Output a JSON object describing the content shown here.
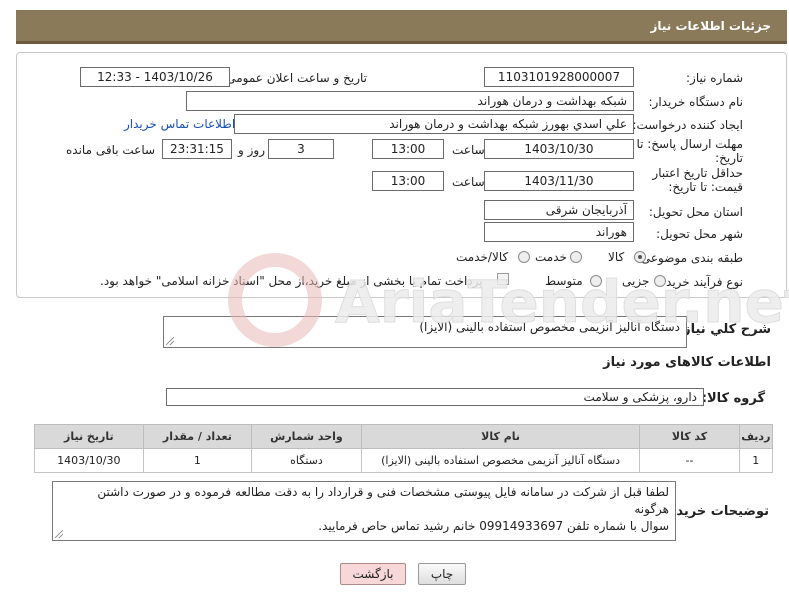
{
  "header": {
    "title": "جزئیات اطلاعات نیاز"
  },
  "form": {
    "need_number_label": "شماره نیاز:",
    "need_number": "1103101928000007",
    "announce_label": "تاریخ و ساعت اعلان عمومی:",
    "announce_value": "1403/10/26 - 12:33",
    "buyer_label": "نام دستگاه خریدار:",
    "buyer_value": "شبکه بهداشت و درمان هوراند",
    "creator_label": "ایجاد کننده درخواست:",
    "creator_value": "علي اسدي بهورز شبکه بهداشت و درمان هوراند",
    "contact_link": "اطلاعات تماس خریدار",
    "deadline_label": "مهلت ارسال پاسخ: تا تاریخ:",
    "deadline_date": "1403/10/30",
    "time_label": "ساعت",
    "deadline_time": "13:00",
    "days_value": "3",
    "days_label": "روز و",
    "remaining_time": "23:31:15",
    "remaining_label": "ساعت باقی مانده",
    "validity_label": "حداقل تاریخ اعتبار قیمت: تا تاریخ:",
    "validity_date": "1403/11/30",
    "validity_time": "13:00",
    "province_label": "استان محل تحویل:",
    "province_value": "آذربایجان شرقی",
    "city_label": "شهر محل تحویل:",
    "city_value": "هوراند",
    "category_label": "طبقه بندی موضوعی:",
    "category_options": [
      "کالا",
      "خدمت",
      "کالا/خدمت"
    ],
    "category_selected": "کالا",
    "process_label": "نوع فرآیند خرید :",
    "process_options": [
      "جزیی",
      "متوسط"
    ],
    "payment_note": "پرداخت تمام یا بخشی از مبلغ خرید،از محل \"اسناد خزانه اسلامی\" خواهد بود."
  },
  "description": {
    "label": "شرح کلي نياز:",
    "value": "دستگاه آنالیز آنزیمی مخصوص استفاده بالینی (الایزا)"
  },
  "goods_section": {
    "title": "اطلاعات کالاهای مورد نیاز",
    "group_label": "گروه کالا:",
    "group_value": "دارو، پزشکی و سلامت"
  },
  "table": {
    "headers": [
      "ردیف",
      "کد کالا",
      "نام کالا",
      "واحد شمارش",
      "تعداد / مقدار",
      "تاریخ نیاز"
    ],
    "rows": [
      [
        "1",
        "--",
        "دستگاه آنالیز آنزیمی مخصوص استفاده بالینی (الایزا)",
        "دستگاه",
        "1",
        "1403/10/30"
      ]
    ]
  },
  "buyer_notes": {
    "label": "توضیحات خریدار:",
    "line1": "لطفا قبل از شرکت در سامانه فایل پیوستی مشخصات فنی و قرارداد را به دقت مطالعه فرموده و در صورت داشتن هرگونه",
    "line2": "سوال با شماره تلفن 09914933697 خانم رشید تماس حاص فرمایید."
  },
  "buttons": {
    "print": "چاپ",
    "back": "بازگشت"
  },
  "watermark": {
    "text": "AriaTender.net"
  },
  "colors": {
    "header_bg": "#8b7a5a",
    "link": "#1a4fb5",
    "back_button_bg": "#f7d7d7"
  }
}
